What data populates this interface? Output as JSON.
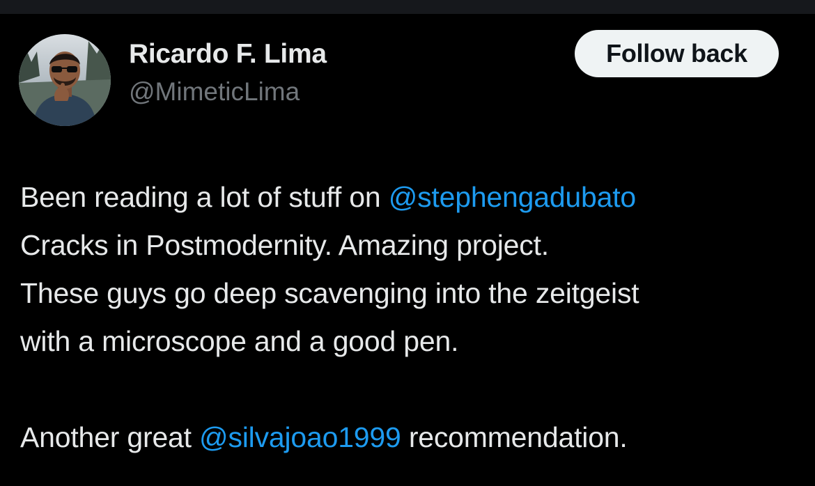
{
  "tweet": {
    "author": {
      "name": "Ricardo F. Lima",
      "handle": "@MimeticLima"
    },
    "follow_button_label": "Follow back",
    "body": {
      "line1_text": "Been reading a lot of stuff on ",
      "line1_mention": "@stephengadubato",
      "line2_text": "Cracks in Postmodernity. Amazing project.",
      "line3_text": "These guys go deep scavenging into the zeitgeist",
      "line4_text": "with a microscope and a good pen.",
      "line6_text_before": "Another great ",
      "line6_mention": "@silvajoao1999",
      "line6_text_after": " recommendation."
    }
  },
  "colors": {
    "background": "#000000",
    "primary_text": "#e7e9ea",
    "secondary_text": "#71767b",
    "link": "#1d9bf0",
    "button_bg": "#eff3f4",
    "button_text": "#0f1419"
  }
}
